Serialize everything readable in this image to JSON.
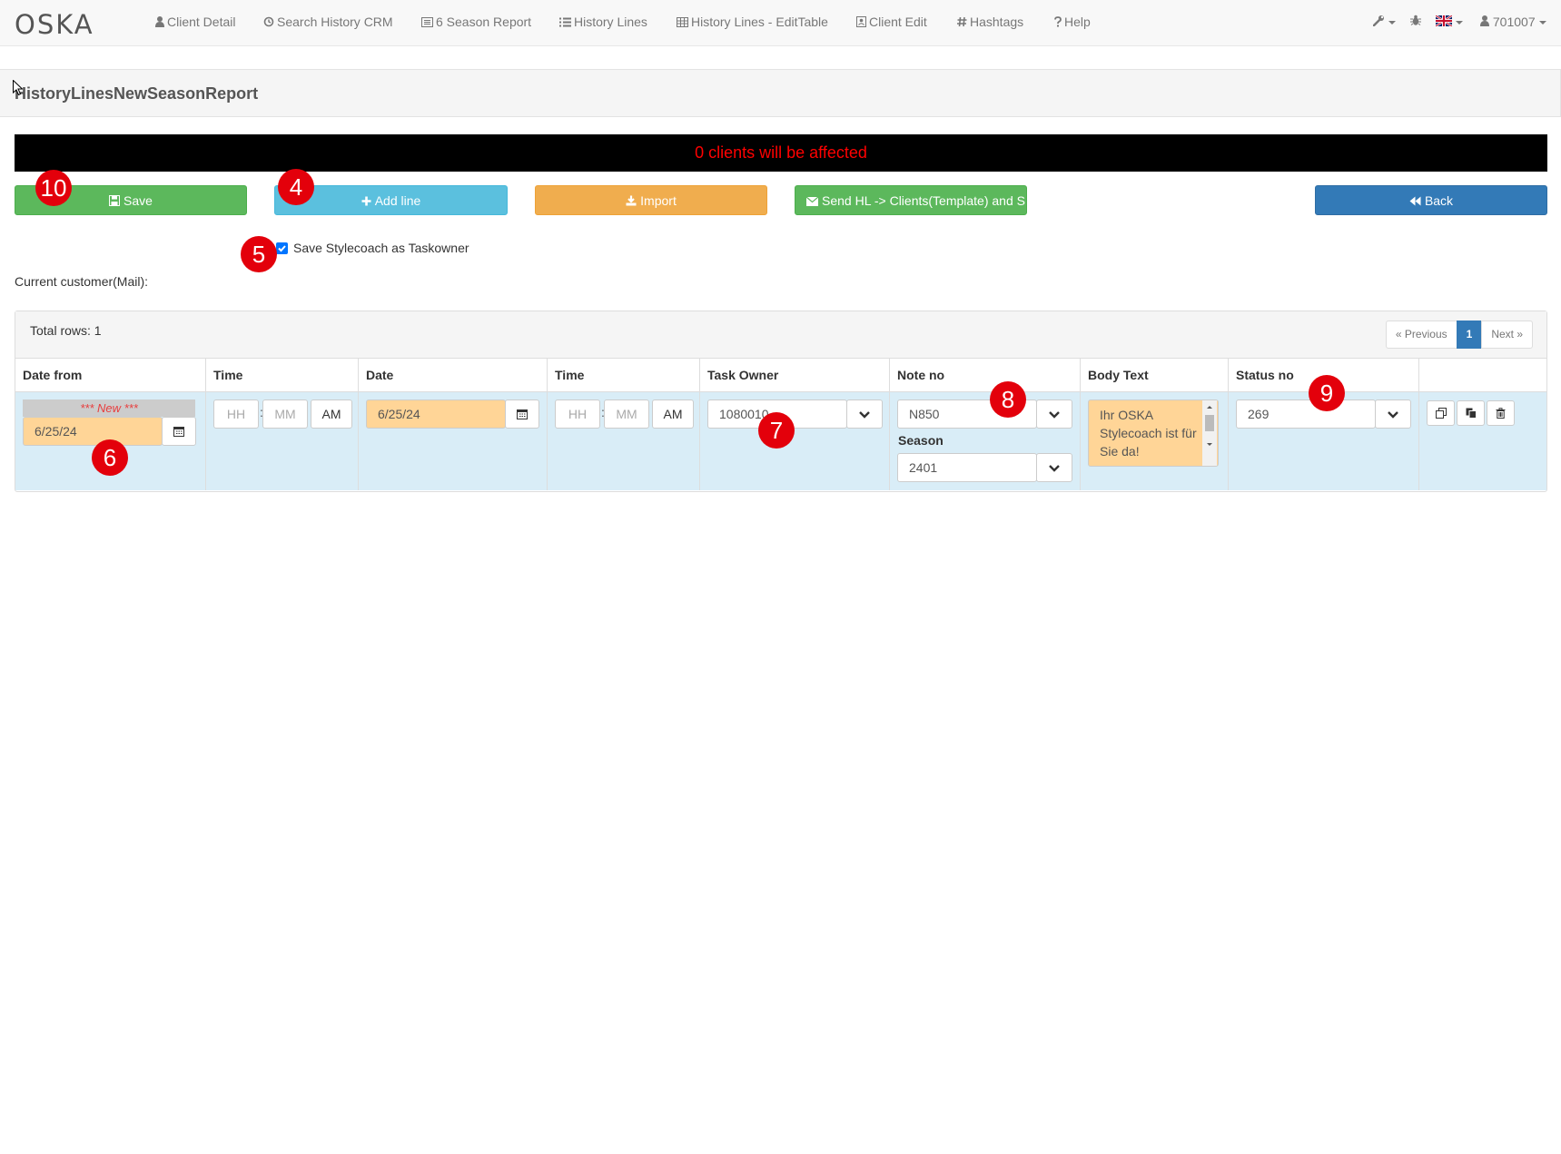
{
  "navbar": {
    "brand": "OSKA",
    "items": [
      {
        "label": "Client Detail",
        "icon": "user-icon"
      },
      {
        "label": "Search History CRM",
        "icon": "history-icon"
      },
      {
        "label": "6 Season Report",
        "icon": "list-alt-icon"
      },
      {
        "label": "History Lines",
        "icon": "list-icon"
      },
      {
        "label": "History Lines - EditTable",
        "icon": "table-icon"
      },
      {
        "label": "Client Edit",
        "icon": "contact-icon"
      },
      {
        "label": "Hashtags",
        "icon": "hashtag-icon"
      },
      {
        "label": "Help",
        "icon": "question-icon"
      }
    ],
    "user_label": "701007"
  },
  "page": {
    "title": "HistoryLinesNewSeasonReport",
    "affected_message": "0 clients will be affected",
    "current_customer_label": "Current customer(Mail):"
  },
  "toolbar": {
    "save_label": "Save",
    "add_line_label": "Add line",
    "import_label": "Import",
    "send_label": "Send HL -> Clients(Template) and S",
    "back_label": "Back"
  },
  "options": {
    "save_stylecoach_label": "Save Stylecoach as Taskowner",
    "save_stylecoach_checked": true
  },
  "table": {
    "total_rows_label": "Total rows: 1",
    "pagination": {
      "previous": "« Previous",
      "current": "1",
      "next": "Next »"
    },
    "columns": [
      "Date from",
      "Time",
      "Date",
      "Time",
      "Task Owner",
      "Note no",
      "Body Text",
      "Status no",
      ""
    ],
    "row": {
      "new_label": "*** New ***",
      "date_from": "6/25/24",
      "time1_hh": "HH",
      "time1_mm": "MM",
      "time1_ampm": "AM",
      "date": "6/25/24",
      "time2_hh": "HH",
      "time2_mm": "MM",
      "time2_ampm": "AM",
      "task_owner": "1080010",
      "note_no": "N850",
      "season_label": "Season",
      "season": "2401",
      "body_text": "Ihr OSKA Stylecoach ist für Sie da!",
      "status_no": "269"
    }
  },
  "annotations": [
    "10",
    "4",
    "5",
    "6",
    "7",
    "8",
    "9"
  ],
  "colors": {
    "save": "#5cb85c",
    "add_line": "#5bc0de",
    "import": "#f0ad4e",
    "send": "#5cb85c",
    "back": "#337ab7",
    "highlight_field": "#ffd597",
    "row_background": "#d9edf7",
    "annotation_badge": "#e3000b",
    "affected_text": "#ff0000"
  }
}
